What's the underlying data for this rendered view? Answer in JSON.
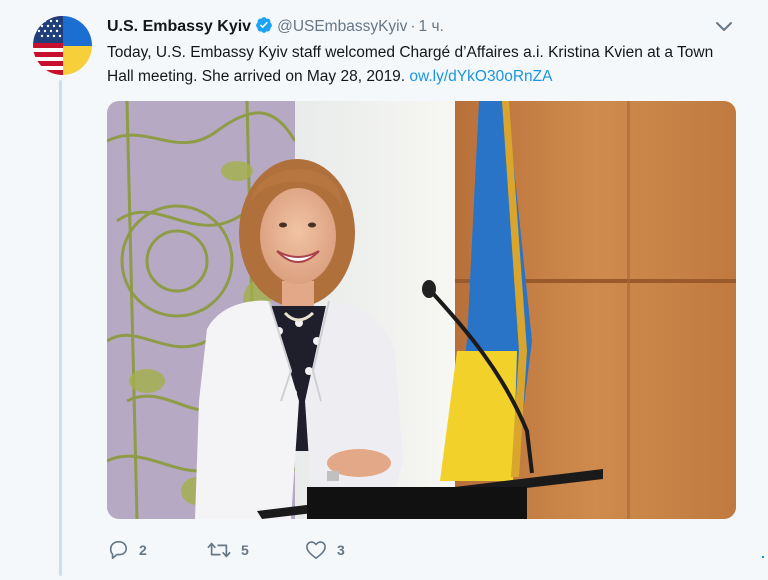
{
  "tweet": {
    "author_name": "U.S. Embassy Kyiv",
    "handle": "@USEmbassyKyiv",
    "separator": "·",
    "time": "1 ч.",
    "text": "Today, U.S. Embassy Kyiv staff welcomed Chargé d’Affaires a.i. Kristina Kvien at a Town Hall meeting. She arrived on May 28, 2019. ",
    "link": "ow.ly/dYkO30oRnZA"
  },
  "actions": {
    "reply_count": "2",
    "retweet_count": "5",
    "like_count": "3"
  },
  "icons": {
    "verified": "verified-badge-icon",
    "caret": "chevron-down-icon",
    "reply": "reply-icon",
    "retweet": "retweet-icon",
    "like": "heart-icon"
  },
  "colors": {
    "background": "#f5f8fa",
    "link": "#1b95e0",
    "muted": "#657786",
    "thread_line": "#c4e2f2",
    "ukraine_blue": "#1c6fd0",
    "ukraine_yellow": "#f6cf3a"
  }
}
